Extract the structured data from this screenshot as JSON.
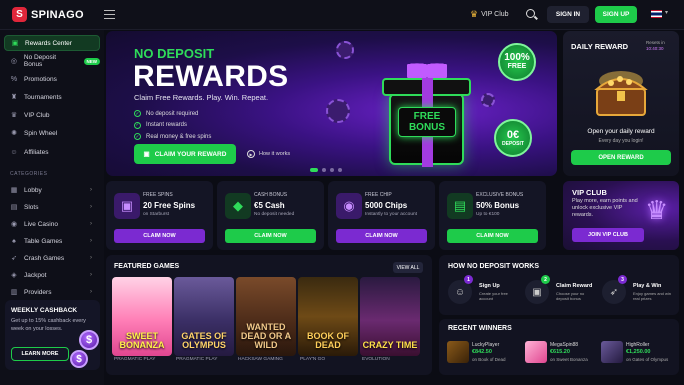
{
  "brand": {
    "name": "SPINAGO"
  },
  "header": {
    "vip_label": "VIP Club",
    "signin": "SIGN IN",
    "signup": "SIGN UP"
  },
  "sidebar": {
    "items": [
      {
        "label": "Rewards Center",
        "icon": "gift-icon"
      },
      {
        "label": "No Deposit Bonus",
        "icon": "coin-icon",
        "badge": "NEW"
      },
      {
        "label": "Promotions",
        "icon": "percent-icon"
      },
      {
        "label": "Tournaments",
        "icon": "trophy-icon"
      },
      {
        "label": "VIP Club",
        "icon": "crown-icon"
      },
      {
        "label": "Spin Wheel",
        "icon": "wheel-icon"
      },
      {
        "label": "Affiliates",
        "icon": "users-icon"
      }
    ],
    "categories_heading": "CATEGORIES",
    "categories": [
      {
        "label": "Lobby",
        "icon": "grid-icon"
      },
      {
        "label": "Slots",
        "icon": "slot-icon"
      },
      {
        "label": "Live Casino",
        "icon": "live-icon"
      },
      {
        "label": "Table Games",
        "icon": "cards-icon"
      },
      {
        "label": "Crash Games",
        "icon": "rocket-icon"
      },
      {
        "label": "Jackpot",
        "icon": "jackpot-icon"
      },
      {
        "label": "Providers",
        "icon": "providers-icon"
      }
    ],
    "cashback": {
      "title": "WEEKLY CASHBACK",
      "text": "Get up to 15% cashback every week on your losses.",
      "button": "LEARN MORE",
      "coin": "$"
    }
  },
  "hero": {
    "eyebrow": "NO DEPOSIT",
    "title": "REWARDS",
    "subtitle": "Claim Free Rewards. Play. Win. Repeat.",
    "bullets": [
      "No deposit required",
      "Instant rewards",
      "Real money & free spins"
    ],
    "cta": "CLAIM YOUR REWARD",
    "how": "How it works",
    "gift_line1": "FREE",
    "gift_line2": "BONUS",
    "badge_big": "100%",
    "badge_small": "FREE",
    "dep_big": "0€",
    "dep_small": "DEPOSIT"
  },
  "daily": {
    "title": "DAILY REWARD",
    "resets_label": "Resets in",
    "resets_time": "10:40:30",
    "msg": "Open your daily reward",
    "msg2": "Every day you login!",
    "button": "OPEN REWARD"
  },
  "promos": [
    {
      "label": "FREE SPINS",
      "value": "20 Free Spins",
      "sub": "on Starburst",
      "cta": "CLAIM NOW",
      "icon": "gift-icon"
    },
    {
      "label": "CASH BONUS",
      "value": "€5 Cash",
      "sub": "No deposit needed",
      "cta": "CLAIM NOW",
      "icon": "gem-icon"
    },
    {
      "label": "FREE CHIP",
      "value": "5000 Chips",
      "sub": "Instantly to your account",
      "cta": "CLAIM NOW",
      "icon": "chip-icon"
    },
    {
      "label": "EXCLUSIVE BONUS",
      "value": "50% Bonus",
      "sub": "Up to €100",
      "cta": "CLAIM NOW",
      "icon": "cash-icon"
    }
  ],
  "vip": {
    "title": "VIP CLUB",
    "desc": "Play more, earn points and unlock exclusive VIP rewards.",
    "button": "JOIN VIP CLUB"
  },
  "featured": {
    "title": "FEATURED GAMES",
    "view_all": "VIEW ALL",
    "games": [
      {
        "name": "SWEET BONANZA",
        "provider": "PRAGMATIC PLAY"
      },
      {
        "name": "GATES OF OLYMPUS",
        "provider": "PRAGMATIC PLAY"
      },
      {
        "name": "WANTED DEAD OR A WILD",
        "provider": "HACKSAW GAMING"
      },
      {
        "name": "BOOK OF DEAD",
        "provider": "PLAY'N GO"
      },
      {
        "name": "CRAZY TIME",
        "provider": "EVOLUTION"
      }
    ]
  },
  "how_it_works": {
    "title": "HOW NO DEPOSIT WORKS",
    "steps": [
      {
        "num": "1",
        "title": "Sign Up",
        "desc": "Create your free account"
      },
      {
        "num": "2",
        "title": "Claim Reward",
        "desc": "Choose your no deposit bonus"
      },
      {
        "num": "3",
        "title": "Play & Win",
        "desc": "Enjoy games and win real prizes"
      }
    ]
  },
  "winners": {
    "title": "RECENT WINNERS",
    "list": [
      {
        "user": "LuckyPlayer",
        "amount": "€842.50",
        "game": "on Book of Dead"
      },
      {
        "user": "MegaSpin88",
        "amount": "€615.20",
        "game": "on Sweet Bonanza"
      },
      {
        "user": "HighRoller",
        "amount": "€1,250.00",
        "game": "on Gates of Olympus"
      }
    ]
  },
  "colors": {
    "accent": "#1ecb4a",
    "purple": "#7b2ad1",
    "brand": "#e1263a"
  }
}
